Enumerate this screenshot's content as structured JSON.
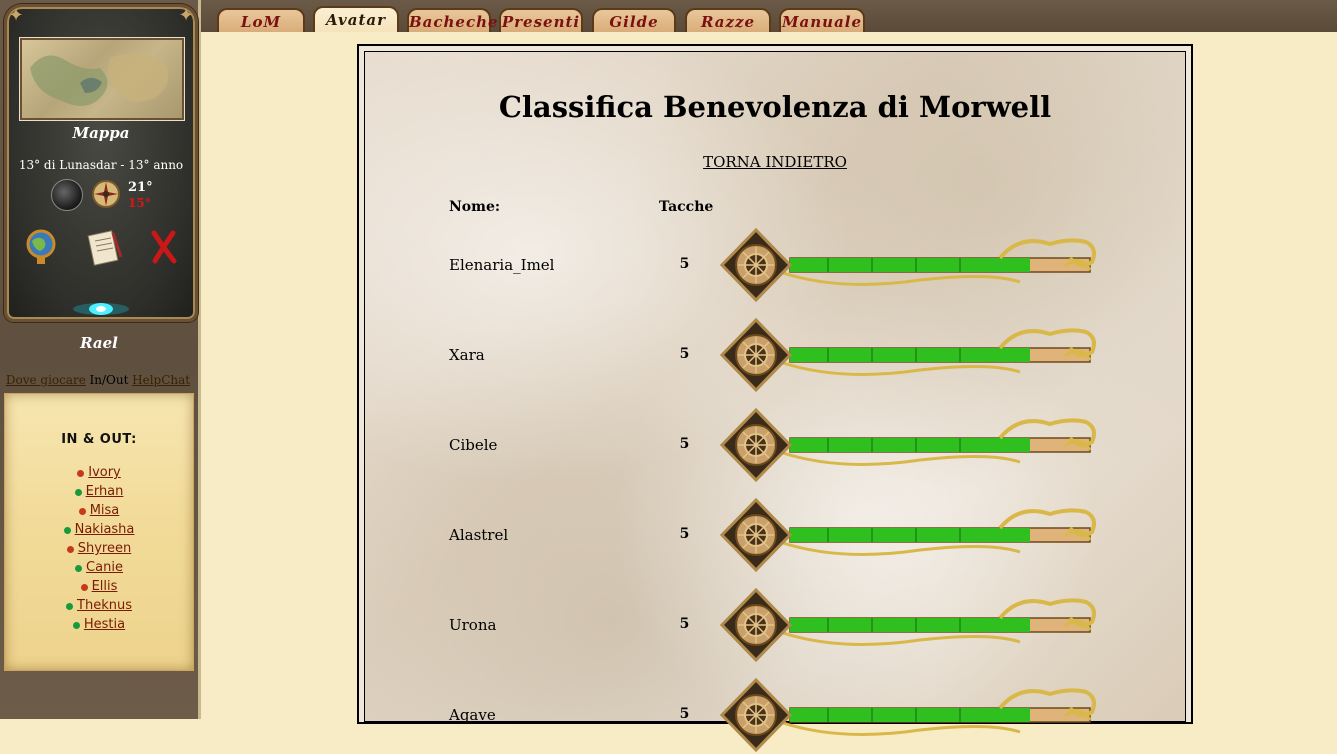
{
  "sidebar": {
    "map_label": "Mappa",
    "date": "13° di Lunasdar - 13° anno",
    "temp_high": "21°",
    "temp_low": "15°",
    "character_name": "Rael",
    "tabs": [
      "Dove giocare",
      "In/Out",
      "HelpChat"
    ],
    "inout_title": "IN & OUT:",
    "users": [
      {
        "name": "Ivory",
        "status": "red"
      },
      {
        "name": "Erhan",
        "status": "green"
      },
      {
        "name": "Misa",
        "status": "red"
      },
      {
        "name": "Nakiasha",
        "status": "green"
      },
      {
        "name": "Shyreen",
        "status": "red"
      },
      {
        "name": "Canie",
        "status": "green"
      },
      {
        "name": "Ellis",
        "status": "red"
      },
      {
        "name": "Theknus",
        "status": "green"
      },
      {
        "name": "Hestia",
        "status": "green"
      }
    ],
    "icons": [
      "globe-icon",
      "scroll-icon",
      "close-icon",
      "moon-phase-icon",
      "compass-icon"
    ]
  },
  "tabs": [
    "LoM",
    "Avatar",
    "Bacheche",
    "Presenti",
    "Gilde",
    "Razze",
    "Manuale"
  ],
  "active_tab": "Avatar",
  "main": {
    "title": "Classifica Benevolenza di Morwell",
    "back_link": "TORNA INDIETRO",
    "col_name": "Nome:",
    "col_value": "Tacche",
    "rows": [
      {
        "name": "Elenaria_Imel",
        "value": "5",
        "fill": 0.8
      },
      {
        "name": "Xara",
        "value": "5",
        "fill": 0.8
      },
      {
        "name": "Cibele",
        "value": "5",
        "fill": 0.8
      },
      {
        "name": "Alastrel",
        "value": "5",
        "fill": 0.8
      },
      {
        "name": "Urona",
        "value": "5",
        "fill": 0.8
      },
      {
        "name": "Agave",
        "value": "5",
        "fill": 0.8
      }
    ]
  },
  "colors": {
    "status_red": "#c8381c",
    "status_green": "#169a3a",
    "bar_fill": "#2fbf1f",
    "bar_empty": "#e0b37a"
  }
}
